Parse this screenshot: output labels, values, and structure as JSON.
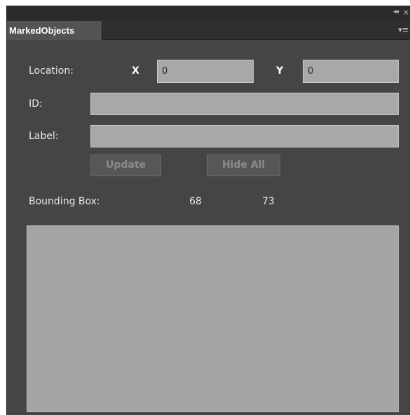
{
  "panel": {
    "tab_title": "MarkedObjects",
    "collapse_icon": "double-left-arrow-icon",
    "close_icon": "close-icon",
    "menu_icon": "panel-menu-icon"
  },
  "location": {
    "label": "Location:",
    "x_label": "X",
    "x_value": "0",
    "y_label": "Y",
    "y_value": "0"
  },
  "id_field": {
    "label": "ID:",
    "value": ""
  },
  "label_field": {
    "label": "Label:",
    "value": ""
  },
  "buttons": {
    "update": "Update",
    "hide_all": "Hide All"
  },
  "bounding_box": {
    "label": "Bounding Box:",
    "width": "68",
    "height": "73"
  }
}
